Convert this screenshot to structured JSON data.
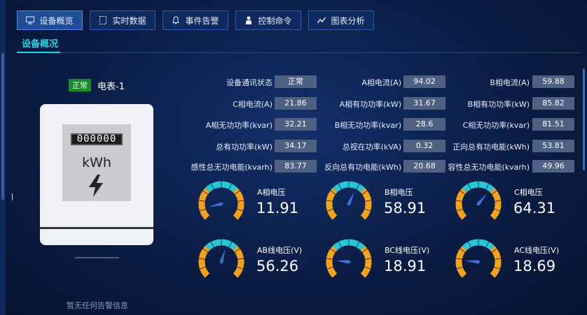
{
  "tabs": [
    {
      "label": "设备概览",
      "icon": "monitor-icon",
      "active": true
    },
    {
      "label": "实时数据",
      "icon": "document-icon",
      "active": false
    },
    {
      "label": "事件告警",
      "icon": "bell-icon",
      "active": false
    },
    {
      "label": "控制命令",
      "icon": "user-icon",
      "active": false
    },
    {
      "label": "图表分析",
      "icon": "line-chart-icon",
      "active": false
    }
  ],
  "section_title": "设备概况",
  "device": {
    "status": "正常",
    "name": "电表-1",
    "display_digits": "000000",
    "unit": "kWh"
  },
  "no_alarm": "暂无任何告警信息",
  "metrics": [
    {
      "label": "设备通讯状态",
      "value": "正常"
    },
    {
      "label": "A相电流(A)",
      "value": "94.02"
    },
    {
      "label": "B相电流(A)",
      "value": "59.88"
    },
    {
      "label": "C相电流(A)",
      "value": "21.86"
    },
    {
      "label": "A相有功功率(kW)",
      "value": "31.67"
    },
    {
      "label": "B相有功功率(kW)",
      "value": "85.82"
    },
    {
      "label": "A相无功功率(kvar)",
      "value": "32.21"
    },
    {
      "label": "B相无功功率(kvar)",
      "value": "28.6"
    },
    {
      "label": "C相无功功率(kvar)",
      "value": "81.51"
    },
    {
      "label": "总有功功率(kW)",
      "value": "34.17"
    },
    {
      "label": "总视在功率(kVA)",
      "value": "0.32"
    },
    {
      "label": "正向总有功电能(kWh)",
      "value": "53.81"
    },
    {
      "label": "感性总无功电能(kvarh)",
      "value": "83.77"
    },
    {
      "label": "反向总有功电能(kWh)",
      "value": "20.68"
    },
    {
      "label": "容性总无功电能(kvarh)",
      "value": "49.96"
    }
  ],
  "gauges": [
    {
      "label": "A相电压",
      "value": "11.91",
      "reading": 11.91
    },
    {
      "label": "B相电压",
      "value": "58.91",
      "reading": 58.91
    },
    {
      "label": "C相电压",
      "value": "64.31",
      "reading": 64.31
    },
    {
      "label": "AB线电压(V)",
      "value": "56.26",
      "reading": 56.26
    },
    {
      "label": "BC线电压(V)",
      "value": "18.91",
      "reading": 18.91
    },
    {
      "label": "AC线电压(V)",
      "value": "18.69",
      "reading": 18.69
    }
  ],
  "gauge_scale": {
    "min": 0,
    "max": 100
  },
  "colors": {
    "accent": "#29d3e6",
    "gauge_orange": "#f5a21b",
    "gauge_cyan": "#27c7d8",
    "status_green": "#1b8a2e"
  }
}
